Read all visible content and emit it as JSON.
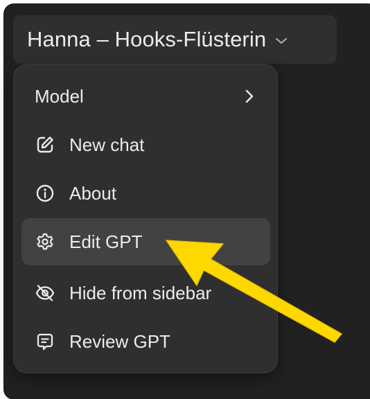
{
  "header": {
    "title": "Hanna – Hooks-Flüsterin",
    "chevron_icon": "chevron-down-icon"
  },
  "menu": {
    "items": [
      {
        "id": "model",
        "label": "Model",
        "icon": "none",
        "trailing_icon": "chevron-right-icon"
      },
      {
        "id": "new-chat",
        "label": "New chat",
        "icon": "pencil-square-icon"
      },
      {
        "id": "about",
        "label": "About",
        "icon": "info-circle-icon"
      },
      {
        "id": "edit-gpt",
        "label": "Edit GPT",
        "icon": "gear-icon",
        "highlighted": true
      },
      {
        "id": "hide-from-sidebar",
        "label": "Hide from sidebar",
        "icon": "eye-slash-icon"
      },
      {
        "id": "review-gpt",
        "label": "Review GPT",
        "icon": "chat-bubble-icon"
      }
    ]
  },
  "annotation": {
    "arrow_color": "#ffd800",
    "arrow_icon": "pointer-arrow"
  },
  "colors": {
    "background": "#212121",
    "menu_background": "#2f2f2f",
    "highlight": "#424242",
    "text": "#ececec"
  }
}
